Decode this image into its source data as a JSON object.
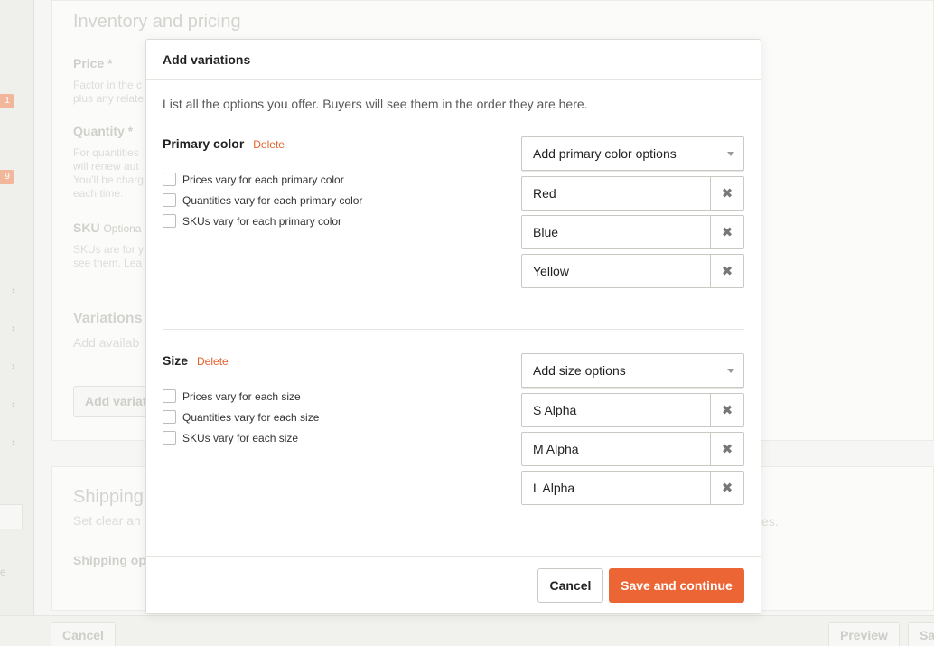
{
  "background": {
    "section_title": "Inventory and pricing",
    "price_label": "Price *",
    "price_help": [
      "Factor in the c",
      "plus any relate"
    ],
    "quantity_label": "Quantity *",
    "quantity_help": [
      "For quantities",
      "will renew aut",
      "You'll be charg",
      "each time."
    ],
    "sku_label": "SKU",
    "sku_optional": "Optiona",
    "sku_help": [
      "SKUs are for y",
      "see them. Lea"
    ],
    "variations_title": "Variations",
    "variations_help": "Add availab",
    "add_variations_button": "Add variat",
    "shipping_title": "Shipping",
    "shipping_help": "Set clear an",
    "shipping_help_tail": "es.",
    "shipping_options_label": "Shipping op",
    "badge_1": "1",
    "badge_2": "9",
    "sidebar_fragment": "e",
    "bottom_cancel": "Cancel",
    "bottom_preview": "Preview",
    "bottom_save": "Sa"
  },
  "modal": {
    "title": "Add variations",
    "intro": "List all the options you offer. Buyers will see them in the order they are here.",
    "sections": [
      {
        "title": "Primary color",
        "delete_label": "Delete",
        "checkboxes": [
          "Prices vary for each primary color",
          "Quantities vary for each primary color",
          "SKUs vary for each primary color"
        ],
        "select_label": "Add primary color options",
        "options": [
          "Red",
          "Blue",
          "Yellow"
        ]
      },
      {
        "title": "Size",
        "delete_label": "Delete",
        "checkboxes": [
          "Prices vary for each size",
          "Quantities vary for each size",
          "SKUs vary for each size"
        ],
        "select_label": "Add size options",
        "options": [
          "S Alpha",
          "M Alpha",
          "L Alpha"
        ]
      }
    ],
    "cancel_label": "Cancel",
    "save_label": "Save and continue"
  },
  "icons": {
    "remove": "close-icon",
    "select_caret": "caret-down-icon",
    "sidebar_chevron": "chevron-right-icon",
    "collapse": "double-chevron-left-icon"
  },
  "colors": {
    "accent": "#ec6534",
    "delete_link": "#e4612e"
  }
}
